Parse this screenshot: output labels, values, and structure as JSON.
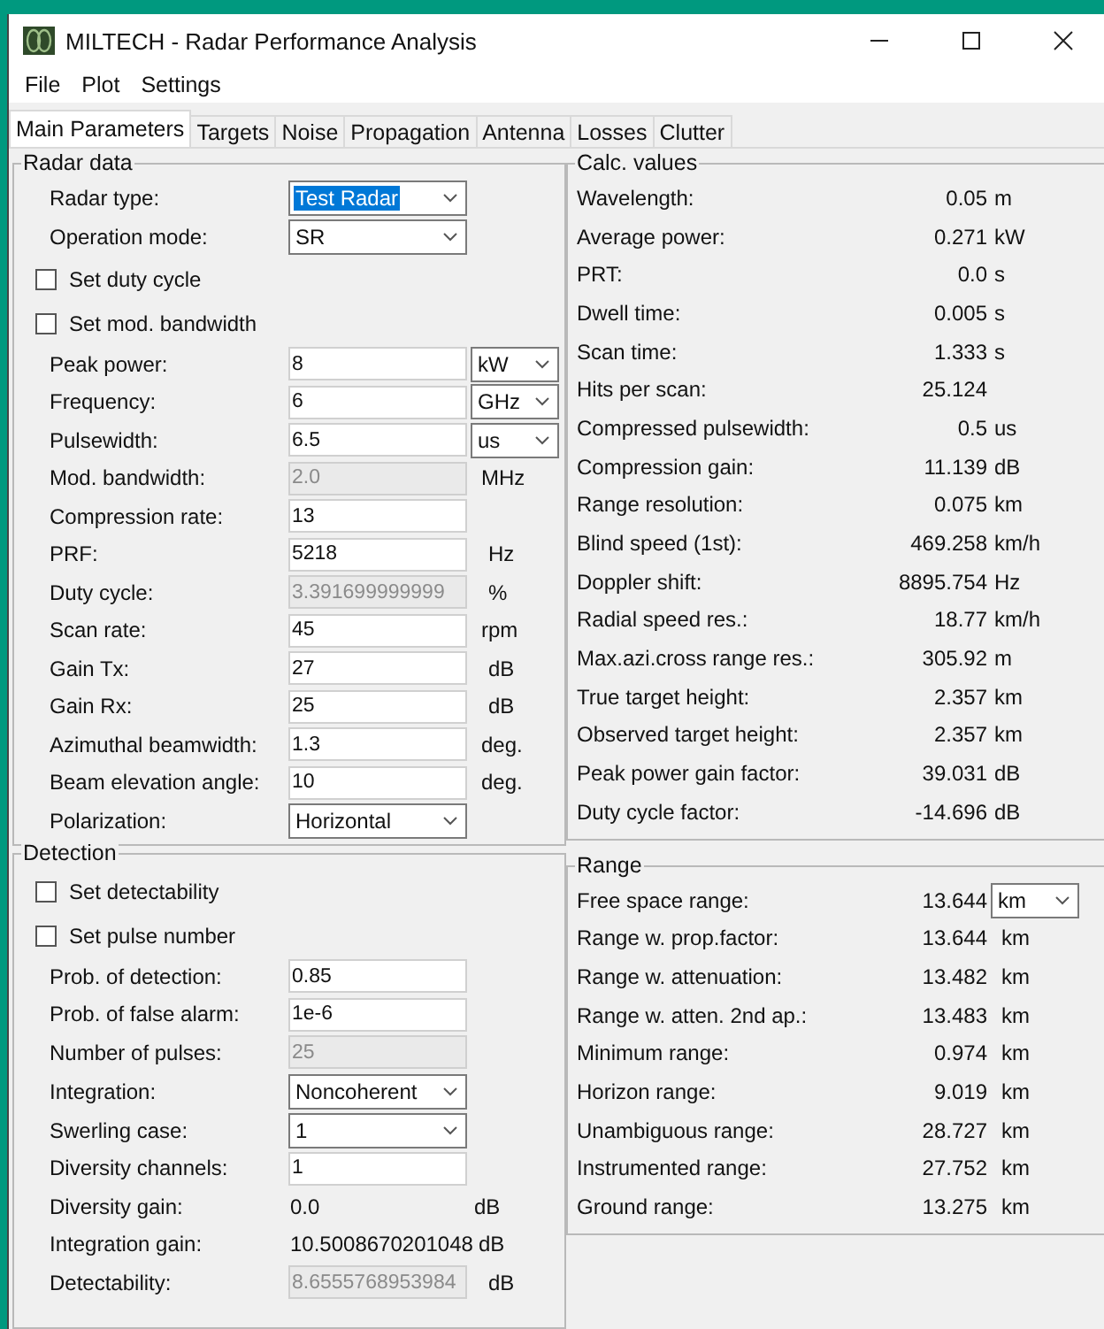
{
  "window": {
    "title": "MILTECH - Radar Performance Analysis"
  },
  "menu": [
    "File",
    "Plot",
    "Settings"
  ],
  "tabs": [
    {
      "label": "Main Parameters",
      "selected": true
    },
    {
      "label": "Targets",
      "selected": false
    },
    {
      "label": "Noise",
      "selected": false
    },
    {
      "label": "Propagation",
      "selected": false
    },
    {
      "label": "Antenna",
      "selected": false
    },
    {
      "label": "Losses",
      "selected": false
    },
    {
      "label": "Clutter",
      "selected": false
    }
  ],
  "radar_data": {
    "title": "Radar data",
    "rows": [
      {
        "kind": "select",
        "label": "Radar type:",
        "value": "Test Radar",
        "focused": true
      },
      {
        "kind": "select",
        "label": "Operation mode:",
        "value": "SR",
        "focused": false
      },
      {
        "kind": "check",
        "label": "Set duty cycle",
        "checked": false
      },
      {
        "kind": "check",
        "label": "Set mod. bandwidth",
        "checked": false
      },
      {
        "kind": "input",
        "label": "Peak power:",
        "value": "8",
        "disabled": false,
        "unit": {
          "kind": "select",
          "text": "kW"
        }
      },
      {
        "kind": "input",
        "label": "Frequency:",
        "value": "6",
        "disabled": false,
        "unit": {
          "kind": "select",
          "text": "GHz"
        }
      },
      {
        "kind": "input",
        "label": "Pulsewidth:",
        "value": "6.5",
        "disabled": false,
        "unit": {
          "kind": "select",
          "text": "us"
        }
      },
      {
        "kind": "input",
        "label": "Mod. bandwidth:",
        "value": "2.0",
        "disabled": true,
        "unit": {
          "kind": "text",
          "text": "MHz"
        }
      },
      {
        "kind": "input",
        "label": "Compression rate:",
        "value": "13",
        "disabled": false
      },
      {
        "kind": "input",
        "label": "PRF:",
        "value": "5218",
        "disabled": false,
        "unit": {
          "kind": "text",
          "text": "Hz"
        }
      },
      {
        "kind": "input",
        "label": "Duty cycle:",
        "value": "3.391699999999",
        "disabled": true,
        "unit": {
          "kind": "text",
          "text": "%"
        }
      },
      {
        "kind": "input",
        "label": "Scan rate:",
        "value": "45",
        "disabled": false,
        "unit": {
          "kind": "text",
          "text": "rpm"
        }
      },
      {
        "kind": "input",
        "label": "Gain Tx:",
        "value": "27",
        "disabled": false,
        "unit": {
          "kind": "text",
          "text": "dB"
        }
      },
      {
        "kind": "input",
        "label": "Gain Rx:",
        "value": "25",
        "disabled": false,
        "unit": {
          "kind": "text",
          "text": "dB"
        }
      },
      {
        "kind": "input",
        "label": "Azimuthal beamwidth:",
        "value": "1.3",
        "disabled": false,
        "unit": {
          "kind": "text",
          "text": "deg."
        }
      },
      {
        "kind": "input",
        "label": "Beam elevation angle:",
        "value": "10",
        "disabled": false,
        "unit": {
          "kind": "text",
          "text": "deg."
        }
      },
      {
        "kind": "select",
        "label": "Polarization:",
        "value": "Horizontal",
        "focused": false
      }
    ]
  },
  "detection": {
    "title": "Detection",
    "rows": [
      {
        "kind": "check",
        "label": "Set detectability",
        "checked": false
      },
      {
        "kind": "check",
        "label": "Set pulse number",
        "checked": false
      },
      {
        "kind": "input",
        "label": "Prob. of detection:",
        "value": "0.85",
        "disabled": false
      },
      {
        "kind": "input",
        "label": "Prob. of false alarm:",
        "value": "1e-6",
        "disabled": false
      },
      {
        "kind": "input",
        "label": "Number of pulses:",
        "value": "25",
        "disabled": true
      },
      {
        "kind": "select",
        "label": "Integration:",
        "value": "Noncoherent",
        "focused": false
      },
      {
        "kind": "select",
        "label": "Swerling case:",
        "value": "1",
        "focused": false
      },
      {
        "kind": "input",
        "label": "Diversity channels:",
        "value": "1",
        "disabled": false
      },
      {
        "kind": "readout",
        "label": "Diversity gain:",
        "value": "0.0",
        "unit": {
          "kind": "text",
          "text": "dB"
        }
      },
      {
        "kind": "readout",
        "label": "Integration gain:",
        "value": "10.5008670201048",
        "unit": {
          "kind": "text",
          "text": "dB"
        }
      },
      {
        "kind": "input",
        "label": "Detectability:",
        "value": "8.6555768953984",
        "disabled": true,
        "unit": {
          "kind": "text",
          "text": "dB"
        }
      }
    ]
  },
  "calc_values": {
    "title": "Calc. values",
    "rows": [
      {
        "label": "Wavelength:",
        "value": "0.05",
        "unit": "m"
      },
      {
        "label": "Average power:",
        "value": "0.271",
        "unit": "kW"
      },
      {
        "label": "PRT:",
        "value": "0.0",
        "unit": "s"
      },
      {
        "label": "Dwell time:",
        "value": "0.005",
        "unit": "s"
      },
      {
        "label": "Scan time:",
        "value": "1.333",
        "unit": "s"
      },
      {
        "label": "Hits per scan:",
        "value": "25.124"
      },
      {
        "label": "Compressed pulsewidth:",
        "value": "0.5",
        "unit": "us"
      },
      {
        "label": "Compression gain:",
        "value": "11.139",
        "unit": "dB"
      },
      {
        "label": "Range resolution:",
        "value": "0.075",
        "unit": "km"
      },
      {
        "label": "Blind speed (1st):",
        "value": "469.258",
        "unit": "km/h"
      },
      {
        "label": "Doppler shift:",
        "value": "8895.754",
        "unit": "Hz"
      },
      {
        "label": "Radial speed res.:",
        "value": "18.77",
        "unit": "km/h"
      },
      {
        "label": "Max.azi.cross range res.:",
        "value": "305.92",
        "unit": "m"
      },
      {
        "label": "True target height:",
        "value": "2.357",
        "unit": "km"
      },
      {
        "label": "Observed target height:",
        "value": "2.357",
        "unit": "km"
      },
      {
        "label": "Peak power gain factor:",
        "value": "39.031",
        "unit": "dB"
      },
      {
        "label": "Duty cycle factor:",
        "value": "-14.696",
        "unit": "dB"
      }
    ]
  },
  "range": {
    "title": "Range",
    "rows": [
      {
        "label": "Free space range:",
        "value": "13.644",
        "unit": {
          "kind": "select",
          "text": "km"
        }
      },
      {
        "label": "Range w. prop.factor:",
        "value": "13.644",
        "unit": {
          "kind": "text",
          "text": "km"
        }
      },
      {
        "label": "Range w. attenuation:",
        "value": "13.482",
        "unit": {
          "kind": "text",
          "text": "km"
        }
      },
      {
        "label": "Range w. atten. 2nd ap.:",
        "value": "13.483",
        "unit": {
          "kind": "text",
          "text": "km"
        }
      },
      {
        "label": "Minimum range:",
        "value": "0.974",
        "unit": {
          "kind": "text",
          "text": "km"
        }
      },
      {
        "label": "Horizon range:",
        "value": "9.019",
        "unit": {
          "kind": "text",
          "text": "km"
        }
      },
      {
        "label": "Unambiguous range:",
        "value": "28.727",
        "unit": {
          "kind": "text",
          "text": "km"
        }
      },
      {
        "label": "Instrumented range:",
        "value": "27.752",
        "unit": {
          "kind": "text",
          "text": "km"
        }
      },
      {
        "label": "Ground range:",
        "value": "13.275",
        "unit": {
          "kind": "text",
          "text": "km"
        }
      }
    ]
  }
}
